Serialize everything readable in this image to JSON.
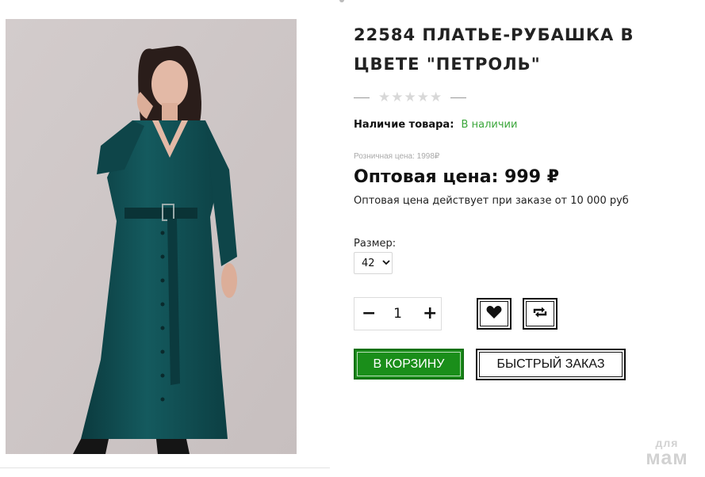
{
  "product": {
    "title": "22584 ПЛАТЬЕ-РУБАШКА В ЦВЕТЕ \"ПЕТРОЛЬ\"",
    "rating": {
      "value": 0,
      "max": 5,
      "icon": "star-icon"
    },
    "availability_label": "Наличие товара:",
    "availability_value": "В наличии",
    "retail_price": "Розничная цена: 1998₽",
    "wholesale_label": "Оптовая цена:",
    "wholesale_value": "999",
    "currency": "₽",
    "wholesale_note": "Оптовая цена действует при заказе от 10 000 руб",
    "size_label": "Размер:",
    "size_selected": "42",
    "quantity": "1",
    "minus": "−",
    "plus": "+",
    "wishlist_icon": "heart-icon",
    "compare_icon": "compare-arrows-icon",
    "cart_button": "В КОРЗИНУ",
    "quick_order_button": "БЫСТРЫЙ ЗАКАЗ"
  },
  "image": {
    "subject": "product-photo"
  },
  "watermark": {
    "line1": "для",
    "line2": "мам"
  },
  "colors": {
    "accent_green": "#1a8e1a",
    "in_stock_green": "#3aa63a",
    "dress_petrol": "#0f4a4e",
    "star_empty": "#d8d8d8"
  }
}
